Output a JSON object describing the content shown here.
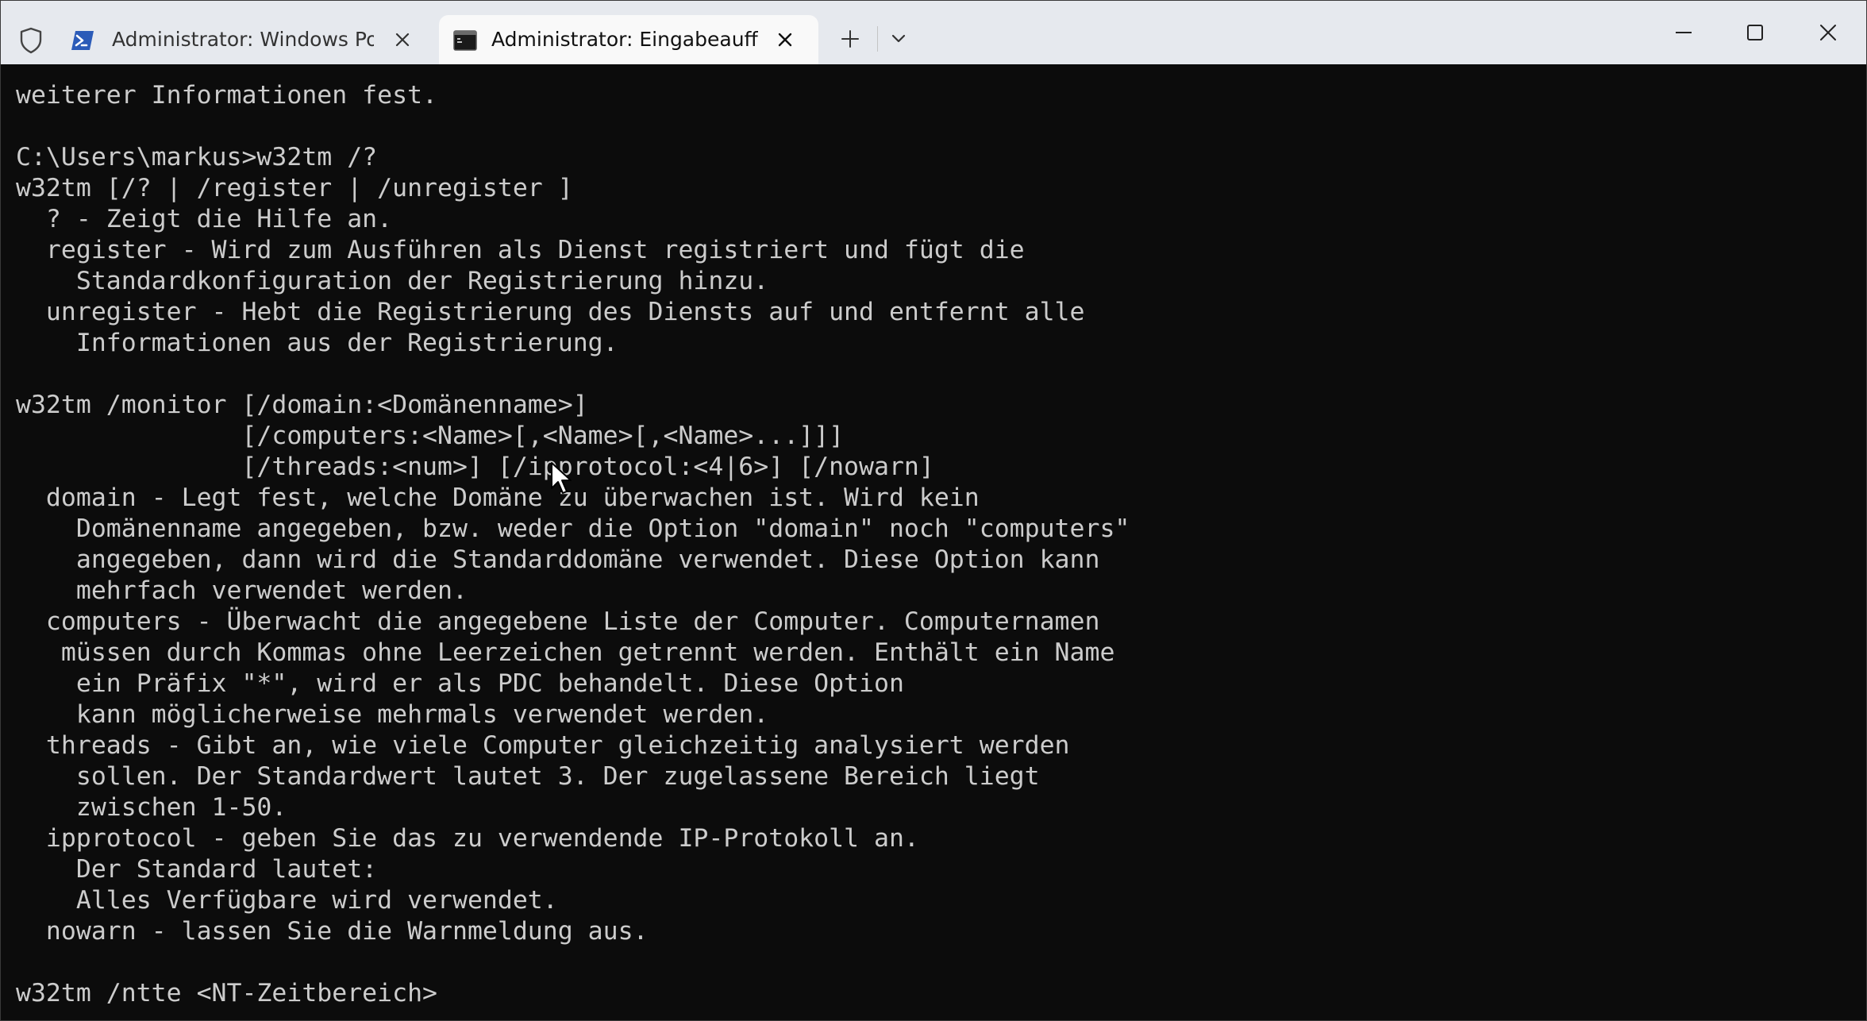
{
  "titlebar": {
    "shield_icon": "shield-icon",
    "tabs": [
      {
        "title": "Administrator: Windows PowerShell",
        "icon": "powershell-icon",
        "active": false
      },
      {
        "title": "Administrator: Eingabeaufforderung",
        "icon": "cmd-icon",
        "active": true
      }
    ],
    "new_tab_label": "+",
    "dropdown_icon": "chevron-down-icon",
    "window_buttons": [
      "minimize-icon",
      "maximize-icon",
      "close-icon"
    ]
  },
  "terminal": {
    "lines": [
      "weiterer Informationen fest.",
      "",
      "C:\\Users\\markus>w32tm /?",
      "w32tm [/? | /register | /unregister ]",
      "  ? - Zeigt die Hilfe an.",
      "  register - Wird zum Ausführen als Dienst registriert und fügt die",
      "    Standardkonfiguration der Registrierung hinzu.",
      "  unregister - Hebt die Registrierung des Diensts auf und entfernt alle",
      "    Informationen aus der Registrierung.",
      "",
      "w32tm /monitor [/domain:<Domänenname>]",
      "               [/computers:<Name>[,<Name>[,<Name>...]]]",
      "               [/threads:<num>] [/ipprotocol:<4|6>] [/nowarn]",
      "  domain - Legt fest, welche Domäne zu überwachen ist. Wird kein",
      "    Domänenname angegeben, bzw. weder die Option \"domain\" noch \"computers\"",
      "    angegeben, dann wird die Standarddomäne verwendet. Diese Option kann",
      "    mehrfach verwendet werden.",
      "  computers - Überwacht die angegebene Liste der Computer. Computernamen",
      "   müssen durch Kommas ohne Leerzeichen getrennt werden. Enthält ein Name",
      "    ein Präfix \"*\", wird er als PDC behandelt. Diese Option",
      "    kann möglicherweise mehrmals verwendet werden.",
      "  threads - Gibt an, wie viele Computer gleichzeitig analysiert werden",
      "    sollen. Der Standardwert lautet 3. Der zugelassene Bereich liegt",
      "    zwischen 1-50.",
      "  ipprotocol - geben Sie das zu verwendende IP-Protokoll an.",
      "    Der Standard lautet:",
      "    Alles Verfügbare wird verwendet.",
      "  nowarn - lassen Sie die Warnmeldung aus.",
      "",
      "w32tm /ntte <NT-Zeitbereich>"
    ]
  },
  "colors": {
    "terminal_bg": "#0c0c0c",
    "terminal_fg": "#cccccc",
    "titlebar_bg": "#e6e9ee",
    "active_tab_bg": "#f9f9f9",
    "powershell_blue": "#2b5bb8"
  },
  "mouse_pointer_icon": "mouse-pointer-icon"
}
